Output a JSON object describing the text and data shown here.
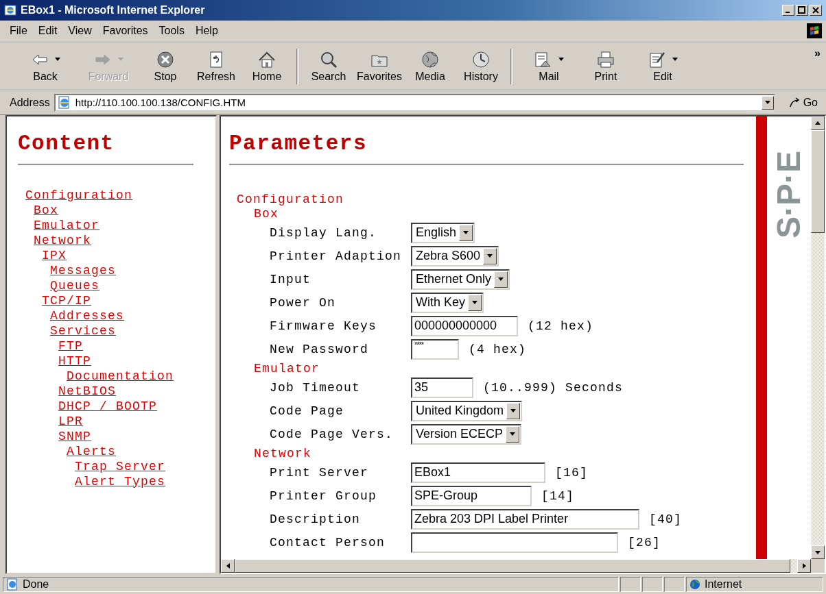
{
  "window": {
    "title": "EBox1 - Microsoft Internet Explorer"
  },
  "menu": [
    {
      "label": "File"
    },
    {
      "label": "Edit"
    },
    {
      "label": "View"
    },
    {
      "label": "Favorites"
    },
    {
      "label": "Tools"
    },
    {
      "label": "Help"
    }
  ],
  "toolbar": {
    "groups": [
      [
        {
          "label": "Back",
          "disabled": false,
          "dropdown": true
        },
        {
          "label": "Forward",
          "disabled": true,
          "dropdown": true
        },
        {
          "label": "Stop",
          "disabled": false,
          "dropdown": false
        },
        {
          "label": "Refresh",
          "disabled": false,
          "dropdown": false
        },
        {
          "label": "Home",
          "disabled": false,
          "dropdown": false
        }
      ],
      [
        {
          "label": "Search",
          "disabled": false,
          "dropdown": false
        },
        {
          "label": "Favorites",
          "disabled": false,
          "dropdown": false
        },
        {
          "label": "Media",
          "disabled": false,
          "dropdown": false
        },
        {
          "label": "History",
          "disabled": false,
          "dropdown": false
        }
      ],
      [
        {
          "label": "Mail",
          "disabled": false,
          "dropdown": true
        },
        {
          "label": "Print",
          "disabled": false,
          "dropdown": false
        },
        {
          "label": "Edit",
          "disabled": false,
          "dropdown": true
        }
      ]
    ],
    "overflow": "»"
  },
  "address_bar": {
    "label": "Address",
    "url": "http://110.100.100.138/CONFIG.HTM",
    "go": "Go"
  },
  "sidebar": {
    "title": "Content",
    "tree": [
      {
        "label": "Configuration",
        "children": [
          {
            "label": "Box"
          },
          {
            "label": "Emulator"
          },
          {
            "label": "Network",
            "children": [
              {
                "label": "IPX",
                "children": [
                  {
                    "label": "Messages"
                  },
                  {
                    "label": "Queues"
                  }
                ]
              },
              {
                "label": "TCP/IP",
                "children": [
                  {
                    "label": "Addresses"
                  },
                  {
                    "label": "Services",
                    "children": [
                      {
                        "label": "FTP"
                      },
                      {
                        "label": "HTTP",
                        "children": [
                          {
                            "label": "Documentation"
                          }
                        ]
                      },
                      {
                        "label": "NetBIOS"
                      },
                      {
                        "label": "DHCP / BOOTP"
                      },
                      {
                        "label": "LPR"
                      },
                      {
                        "label": "SNMP",
                        "children": [
                          {
                            "label": "Alerts",
                            "children": [
                              {
                                "label": "Trap Server"
                              },
                              {
                                "label": "Alert Types"
                              }
                            ]
                          }
                        ]
                      }
                    ]
                  }
                ]
              }
            ]
          }
        ]
      }
    ]
  },
  "main": {
    "title": "Parameters",
    "logo": "S·P·E",
    "section": "Configuration",
    "groups": [
      {
        "heading": "Box",
        "rows": [
          {
            "label": "Display Lang.",
            "kind": "select",
            "value": "English"
          },
          {
            "label": "Printer Adaption",
            "kind": "select",
            "value": "Zebra S600"
          },
          {
            "label": "Input",
            "kind": "select",
            "value": "Ethernet Only"
          },
          {
            "label": "Power On",
            "kind": "select",
            "value": "With Key"
          },
          {
            "label": "Firmware Keys",
            "kind": "text",
            "value": "000000000000",
            "hint": "(12 hex)"
          },
          {
            "label": "New Password",
            "kind": "password",
            "value": "****",
            "hint": "(4 hex)"
          }
        ]
      },
      {
        "heading": "Emulator",
        "rows": [
          {
            "label": "Job Timeout",
            "kind": "text",
            "value": "35",
            "hint": "(10..999) Seconds"
          },
          {
            "label": "Code Page",
            "kind": "select",
            "value": "United Kingdom"
          },
          {
            "label": "Code Page Vers.",
            "kind": "select",
            "value": "Version ECECP"
          }
        ]
      },
      {
        "heading": "Network",
        "rows": [
          {
            "label": "Print Server",
            "kind": "text",
            "value": "EBox1",
            "hint": "[16]"
          },
          {
            "label": "Printer Group",
            "kind": "text",
            "value": "SPE-Group",
            "hint": "[14]"
          },
          {
            "label": "Description",
            "kind": "text",
            "value": "Zebra 203 DPI Label Printer",
            "hint": "[40]"
          },
          {
            "label": "Contact Person",
            "kind": "text",
            "value": "",
            "hint": "[26]"
          }
        ]
      }
    ]
  },
  "status_bar": {
    "text": "Done",
    "zone": "Internet"
  }
}
